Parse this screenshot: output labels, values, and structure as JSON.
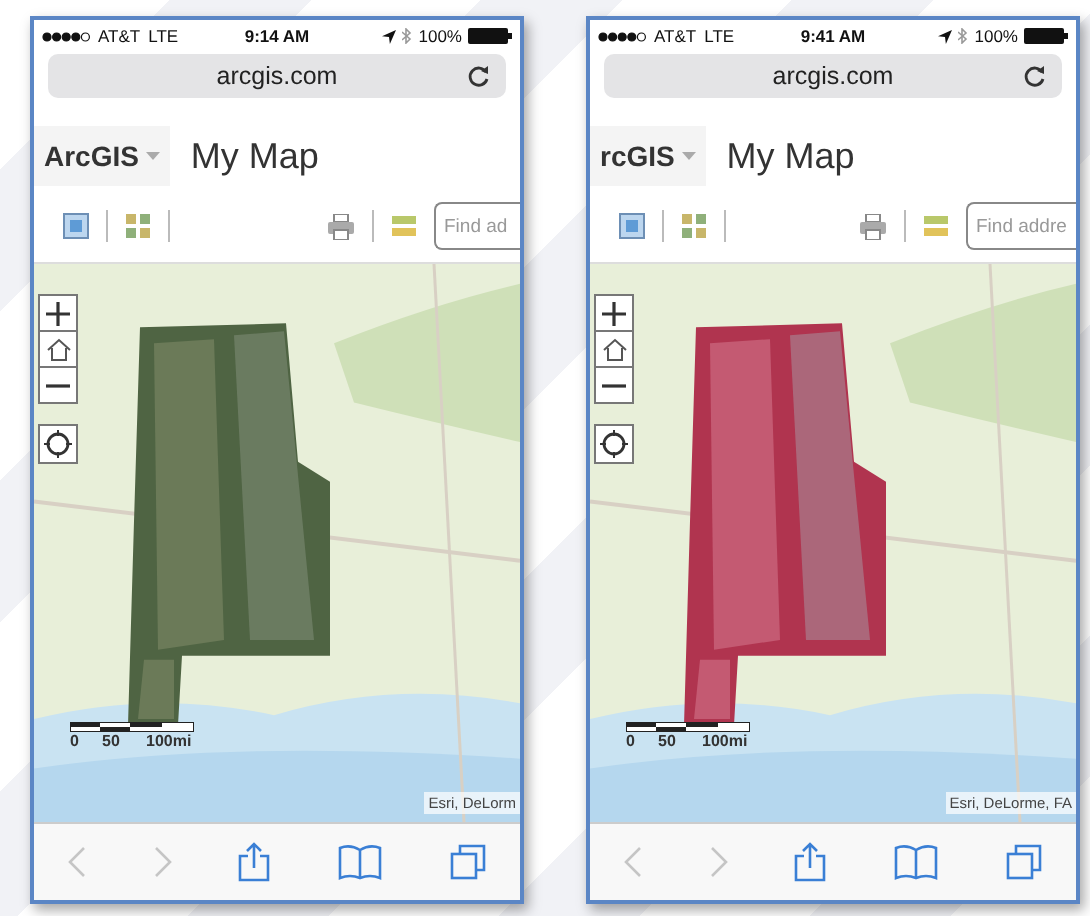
{
  "phones": [
    {
      "status": {
        "carrier": "AT&T",
        "network": "LTE",
        "time": "9:14 AM",
        "battery": "100%"
      },
      "url": "arcgis.com",
      "app_menu": "ArcGIS",
      "title": "My Map",
      "search": {
        "placeholder": "Find ad"
      },
      "map": {
        "scale_labels": [
          "0",
          "50",
          "100mi"
        ],
        "attribution": "Esri, DeLorm"
      },
      "nav": {
        "back_disabled": true,
        "forward_disabled": true
      }
    },
    {
      "status": {
        "carrier": "AT&T",
        "network": "LTE",
        "time": "9:41 AM",
        "battery": "100%"
      },
      "url": "arcgis.com",
      "app_menu": "rcGIS",
      "title": "My Map",
      "search": {
        "placeholder": "Find addre"
      },
      "map": {
        "scale_labels": [
          "0",
          "50",
          "100mi"
        ],
        "attribution": "Esri, DeLorme, FA"
      },
      "nav": {
        "back_disabled": true,
        "forward_disabled": true
      }
    }
  ]
}
